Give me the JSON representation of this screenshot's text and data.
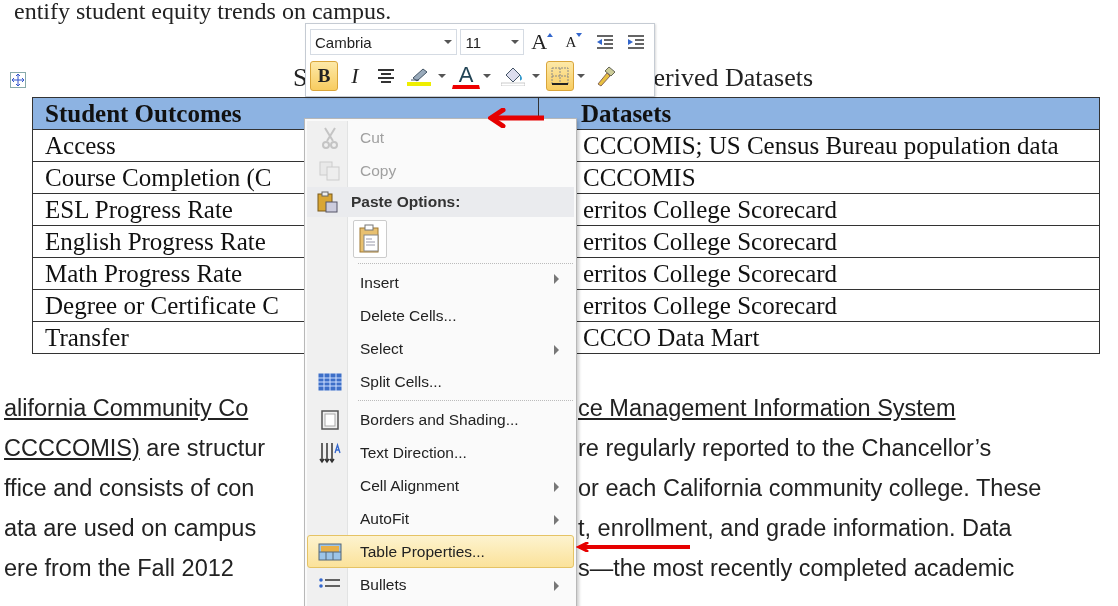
{
  "document": {
    "intro_line": "entify student equity trends on campus.",
    "caption": {
      "left": "S",
      "right": "erived Datasets"
    },
    "table": {
      "columns": [
        "Student Outcomes",
        "Datasets"
      ],
      "rows": [
        [
          "Access",
          "CCCOMIS; US Census Bureau population data"
        ],
        [
          "Course Completion (C",
          "CCCOMIS"
        ],
        [
          "ESL Progress Rate",
          "erritos College Scorecard"
        ],
        [
          "English Progress Rate",
          "erritos College Scorecard"
        ],
        [
          "Math Progress Rate",
          "erritos College Scorecard"
        ],
        [
          "Degree or Certificate C",
          "erritos College Scorecard"
        ],
        [
          "Transfer",
          "CCCO Data Mart"
        ]
      ]
    },
    "paragraph_lines": [
      {
        "left": [
          {
            "text": "alifornia Community Co",
            "underlined": true
          }
        ],
        "right": [
          {
            "text": "ce Management Information System",
            "underlined": true
          }
        ]
      },
      {
        "left": [
          {
            "text": "CCCCOMIS)",
            "underlined": true
          },
          {
            "text": " are structur",
            "underlined": false
          }
        ],
        "right": [
          {
            "text": "re regularly reported to the Chancellor’s",
            "underlined": false
          }
        ]
      },
      {
        "left": [
          {
            "text": "ffice and consists of con",
            "underlined": false
          }
        ],
        "right": [
          {
            "text": "or each California community college. These",
            "underlined": false
          }
        ]
      },
      {
        "left": [
          {
            "text": "ata are used on campus",
            "underlined": false
          }
        ],
        "right": [
          {
            "text": "t, enrollment, and grade information. Data",
            "underlined": false
          }
        ]
      },
      {
        "left": [
          {
            "text": "ere from the Fall 2012",
            "underlined": false
          }
        ],
        "right": [
          {
            "text": "s—the most recently completed academic",
            "underlined": false
          }
        ]
      }
    ]
  },
  "mini_toolbar": {
    "font": "Cambria",
    "size": "11",
    "row_1": [
      {
        "kind": "grow",
        "glyph": "A",
        "selected": false
      },
      {
        "kind": "shrink",
        "glyph": "A",
        "selected": false
      },
      {
        "kind": "outdent",
        "selected": false
      },
      {
        "kind": "indent",
        "selected": false
      }
    ],
    "row_2": [
      {
        "kind": "bold",
        "glyph": "B",
        "selected": true
      },
      {
        "kind": "italic",
        "glyph": "I",
        "selected": false
      },
      {
        "kind": "center",
        "selected": false
      },
      {
        "kind": "highlight",
        "selected": false,
        "dropdown": true
      },
      {
        "kind": "font-color",
        "glyph": "A",
        "selected": false,
        "dropdown": true
      },
      {
        "kind": "shading",
        "selected": false,
        "dropdown": true
      },
      {
        "kind": "borders",
        "selected": true,
        "dropdown": true
      },
      {
        "kind": "painter",
        "selected": false
      }
    ]
  },
  "context_menu": {
    "items": [
      {
        "kind": "scissors",
        "label": "Cut",
        "disabled": true,
        "submenu": false,
        "selected": false,
        "separator_before": false
      },
      {
        "kind": "copy",
        "label": "Copy",
        "disabled": true,
        "submenu": false,
        "selected": false,
        "separator_before": false
      },
      {
        "kind": "paste-header",
        "label": "Paste Options:"
      },
      {
        "kind": "paste-button"
      },
      {
        "kind": "plain",
        "label": "Insert",
        "disabled": false,
        "submenu": true,
        "selected": false,
        "separator_before": true
      },
      {
        "kind": "plain",
        "label": "Delete Cells...",
        "disabled": false,
        "submenu": false,
        "selected": false,
        "separator_before": false
      },
      {
        "kind": "plain",
        "label": "Select",
        "disabled": false,
        "submenu": true,
        "selected": false,
        "separator_before": false
      },
      {
        "kind": "split",
        "label": "Split Cells...",
        "disabled": false,
        "submenu": false,
        "selected": false,
        "separator_before": false
      },
      {
        "kind": "borders",
        "label": "Borders and Shading...",
        "disabled": false,
        "submenu": false,
        "selected": false,
        "separator_before": true
      },
      {
        "kind": "text-direction",
        "label": "Text Direction...",
        "disabled": false,
        "submenu": false,
        "selected": false,
        "separator_before": false
      },
      {
        "kind": "plain",
        "label": "Cell Alignment",
        "disabled": false,
        "submenu": true,
        "selected": false,
        "separator_before": false
      },
      {
        "kind": "plain",
        "label": "AutoFit",
        "disabled": false,
        "submenu": true,
        "selected": false,
        "separator_before": false
      },
      {
        "kind": "table-properties",
        "label": "Table Properties...",
        "disabled": false,
        "submenu": false,
        "selected": true,
        "separator_before": false
      },
      {
        "kind": "bullets",
        "label": "Bullets",
        "disabled": false,
        "submenu": true,
        "selected": false,
        "separator_before": false
      }
    ]
  }
}
